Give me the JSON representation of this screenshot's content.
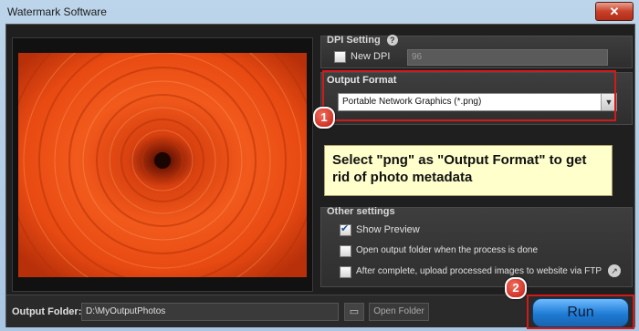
{
  "window": {
    "title": "Watermark Software",
    "close_glyph": "✕"
  },
  "dpi": {
    "header": "DPI Setting",
    "help_glyph": "?",
    "checkbox_label": "New DPI",
    "value": "96",
    "checked": false
  },
  "output_format": {
    "header": "Output Format",
    "selected": "Portable Network Graphics (*.png)",
    "arrow": "▼"
  },
  "callout": {
    "badge": "1",
    "text": "Select \"png\" as \"Output Format\" to get rid of photo metadata"
  },
  "other_settings": {
    "header": "Other settings",
    "items": [
      {
        "label": "Show Preview",
        "checked": true
      },
      {
        "label": "Open output folder when the process is done",
        "checked": false
      },
      {
        "label": "After complete, upload processed images to website via FTP",
        "checked": false
      }
    ],
    "ftp_icon_glyph": "↗"
  },
  "output_folder": {
    "label": "Output Folder:",
    "path": "D:\\MyOutputPhotos",
    "browse_glyph": "▭",
    "open_label": "Open Folder"
  },
  "run": {
    "badge": "2",
    "label": "Run"
  },
  "colors": {
    "accent": "#1e7bd4",
    "highlight": "#d21a1a",
    "callout_bg": "#ffffcc"
  }
}
